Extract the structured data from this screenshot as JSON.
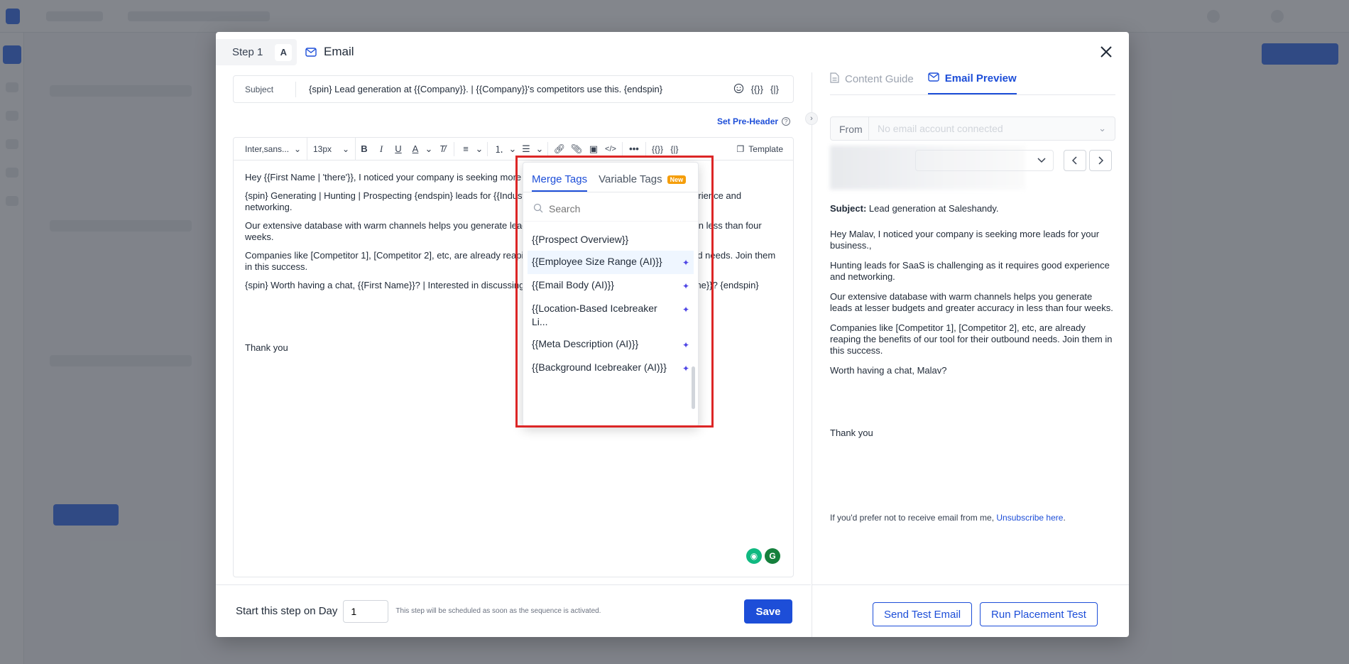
{
  "modal": {
    "step_label": "Step 1",
    "variant": "A",
    "title": "Email"
  },
  "subject": {
    "label": "Subject",
    "value": "{spin} Lead generation at {{Company}}. | {{Company}}'s competitors use this. {endspin}",
    "icons": [
      "emoji-icon",
      "merge-tag-icon",
      "variable-tag-icon"
    ]
  },
  "preheader_label": "Set Pre-Header",
  "toolbar": {
    "font_family": "Inter,sans...",
    "font_size": "13px",
    "template_label": "Template"
  },
  "editor": {
    "paragraphs": [
      "Hey {{First Name | 'there'}}, I noticed your company is seeking more leads for your business.,",
      "{spin} Generating | Hunting | Prospecting {endspin} leads for {{Industry}} is challenging as it requires good experience and networking.",
      "Our extensive database with warm channels helps you generate leads at lesser budgets and greater accuracy in less than four weeks.",
      "Companies like [Competitor 1], [Competitor 2], etc, are already reaping the benefits of our tool for their outbound needs. Join them in this success.",
      "{spin} Worth having a chat, {{First Name}}? | Interested in discussing how we can help {{Company}}, {{First Name}}? {endspin}"
    ],
    "signoff": "Thank you"
  },
  "merge_panel": {
    "tabs": [
      {
        "label": "Merge Tags",
        "active": true
      },
      {
        "label": "Variable Tags",
        "active": false,
        "badge": "New"
      }
    ],
    "search_placeholder": "Search",
    "items": [
      {
        "label": "{{Prospect Overview}}",
        "ai": false
      },
      {
        "label": "{{Employee Size Range (AI)}}",
        "ai": true
      },
      {
        "label": "{{Email Body (AI)}}",
        "ai": true
      },
      {
        "label": "{{Location-Based Icebreaker Li...",
        "ai": true
      },
      {
        "label": "{{Meta Description (AI)}}",
        "ai": true
      },
      {
        "label": "{{Background Icebreaker (AI)}}",
        "ai": true
      }
    ]
  },
  "footer": {
    "start_label": "Start this step on Day",
    "day_value": "1",
    "note": "This step will be scheduled as soon as the sequence is activated.",
    "save_label": "Save"
  },
  "right_panel": {
    "tabs": [
      {
        "label": "Content Guide",
        "active": false
      },
      {
        "label": "Email Preview",
        "active": true
      }
    ],
    "from_label": "From",
    "from_placeholder": "No email account connected",
    "preview": {
      "subject_label": "Subject:",
      "subject_value": "Lead generation at Saleshandy.",
      "paragraphs": [
        "Hey Malav, I noticed your company is seeking more leads for your business.,",
        "Hunting leads for SaaS is challenging as it requires good experience and networking.",
        "Our extensive database with warm channels helps you generate leads at lesser budgets and greater accuracy in less than four weeks.",
        "Companies like [Competitor 1], [Competitor 2], etc, are already reaping the benefits of our tool for their outbound needs. Join them in this success.",
        "Worth having a chat, Malav?"
      ],
      "signoff": "Thank you",
      "unsubscribe_text": "If you'd prefer not to receive email from me, ",
      "unsubscribe_link": "Unsubscribe here",
      "unsubscribe_end": "."
    },
    "send_test_label": "Send Test Email",
    "placement_label": "Run Placement Test"
  },
  "colors": {
    "accent": "#1d4ed8",
    "highlight": "#dc2626",
    "badge": "#f59e0b",
    "sparkle": "#4f46e5"
  }
}
